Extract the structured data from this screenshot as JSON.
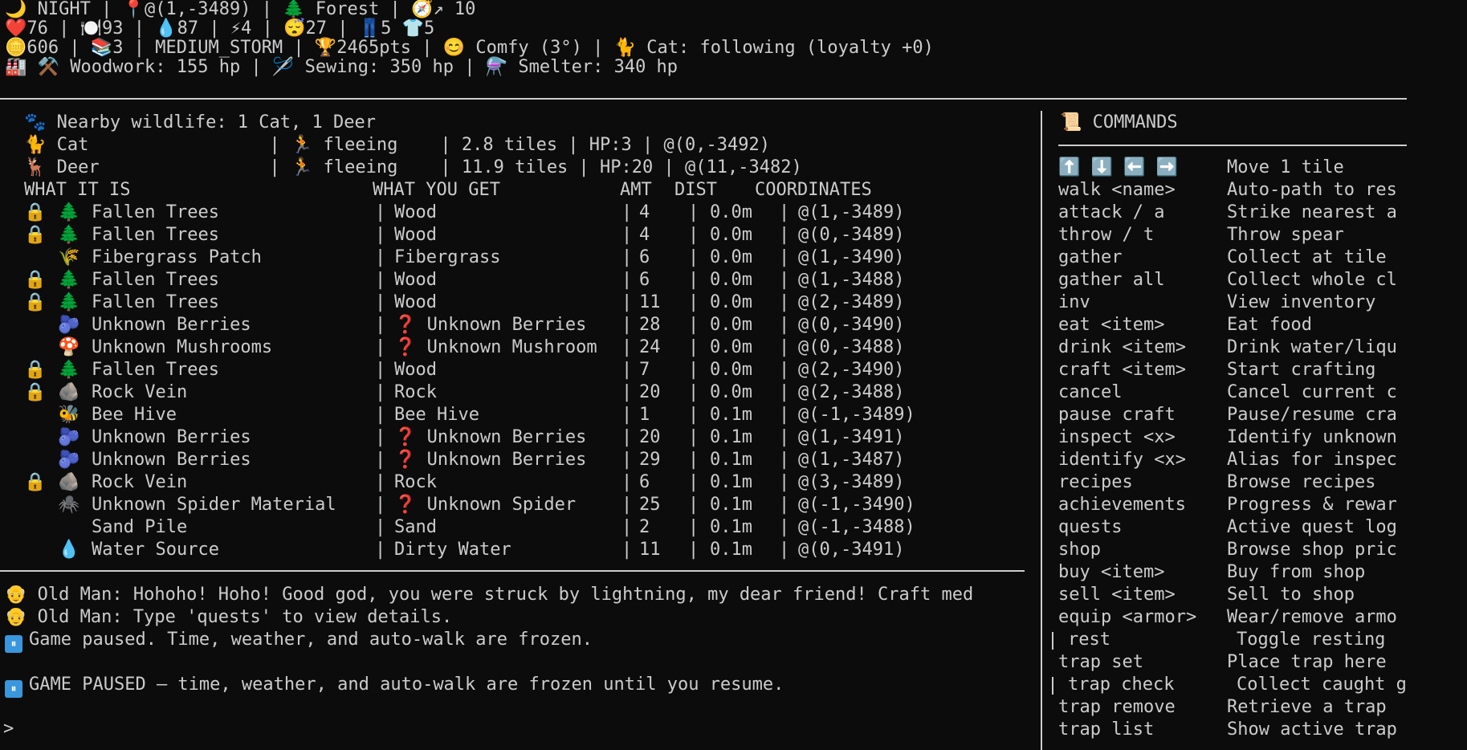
{
  "status": {
    "line1": "🌙 NIGHT | 📍@(1,-3489) | 🌲 Forest | 🧭↗ 10",
    "line2": "❤️76 | 🍽️93 | 💧87 | ⚡4 | 😴27 | 👖5 👕5",
    "line3": "🪙606 | 📚3 | MEDIUM_STORM | 🏆2465pts | 😊 Comfy (3°) | 🐈 Cat: following (loyalty +0)",
    "line4": "🏭 ⚒️ Woodwork: 155 hp | 🪡 Sewing: 350 hp | ⚗️ Smelter: 340 hp"
  },
  "wildlife": {
    "summary": "🐾 Nearby wildlife: 1 Cat, 1 Deer",
    "animals": [
      "🐈 Cat                 | 🏃 fleeing    | 2.8 tiles | HP:3 | @(0,-3492)",
      "🦌 Deer                | 🏃 fleeing    | 11.9 tiles | HP:20 | @(11,-3482)"
    ]
  },
  "table": {
    "headers": {
      "what": "WHAT IT IS",
      "get": "WHAT YOU GET",
      "amt": "AMT",
      "dist": "DIST",
      "coords": "COORDINATES"
    },
    "rows": [
      {
        "lock": "🔒",
        "icon": "🌲",
        "name": "Fallen Trees",
        "get": "Wood",
        "amt": "4",
        "dist": "0.0m",
        "coords": "@(1,-3489)"
      },
      {
        "lock": "🔒",
        "icon": "🌲",
        "name": "Fallen Trees",
        "get": "Wood",
        "amt": "4",
        "dist": "0.0m",
        "coords": "@(0,-3489)"
      },
      {
        "lock": "",
        "icon": "🌾",
        "name": "Fibergrass Patch",
        "get": "Fibergrass",
        "amt": "6",
        "dist": "0.0m",
        "coords": "@(1,-3490)"
      },
      {
        "lock": "🔒",
        "icon": "🌲",
        "name": "Fallen Trees",
        "get": "Wood",
        "amt": "6",
        "dist": "0.0m",
        "coords": "@(1,-3488)"
      },
      {
        "lock": "🔒",
        "icon": "🌲",
        "name": "Fallen Trees",
        "get": "Wood",
        "amt": "11",
        "dist": "0.0m",
        "coords": "@(2,-3489)"
      },
      {
        "lock": "",
        "icon": "🫐",
        "name": "Unknown Berries",
        "get": "❓ Unknown Berries",
        "amt": "28",
        "dist": "0.0m",
        "coords": "@(0,-3490)"
      },
      {
        "lock": "",
        "icon": "🍄",
        "name": "Unknown Mushrooms",
        "get": "❓ Unknown Mushroom",
        "amt": "24",
        "dist": "0.0m",
        "coords": "@(0,-3488)"
      },
      {
        "lock": "🔒",
        "icon": "🌲",
        "name": "Fallen Trees",
        "get": "Wood",
        "amt": "7",
        "dist": "0.0m",
        "coords": "@(2,-3490)"
      },
      {
        "lock": "🔒",
        "icon": "🪨",
        "name": "Rock Vein",
        "get": "Rock",
        "amt": "20",
        "dist": "0.0m",
        "coords": "@(2,-3488)"
      },
      {
        "lock": "",
        "icon": "🐝",
        "name": "Bee Hive",
        "get": "Bee Hive",
        "amt": "1",
        "dist": "0.1m",
        "coords": "@(-1,-3489)"
      },
      {
        "lock": "",
        "icon": "🫐",
        "name": "Unknown Berries",
        "get": "❓ Unknown Berries",
        "amt": "20",
        "dist": "0.1m",
        "coords": "@(1,-3491)"
      },
      {
        "lock": "",
        "icon": "🫐",
        "name": "Unknown Berries",
        "get": "❓ Unknown Berries",
        "amt": "29",
        "dist": "0.1m",
        "coords": "@(1,-3487)"
      },
      {
        "lock": "🔒",
        "icon": "🪨",
        "name": "Rock Vein",
        "get": "Rock",
        "amt": "6",
        "dist": "0.1m",
        "coords": "@(3,-3489)"
      },
      {
        "lock": "",
        "icon": "🕷️",
        "name": "Unknown Spider Material",
        "get": "❓ Unknown Spider",
        "amt": "25",
        "dist": "0.1m",
        "coords": "@(-1,-3490)"
      },
      {
        "lock": "",
        "icon": "",
        "name": "Sand Pile",
        "get": "Sand",
        "amt": "2",
        "dist": "0.1m",
        "coords": "@(-1,-3488)"
      },
      {
        "lock": "",
        "icon": "💧",
        "name": "Water Source",
        "get": "Dirty Water",
        "amt": "11",
        "dist": "0.1m",
        "coords": "@(0,-3491)"
      }
    ]
  },
  "messages": {
    "m1": "👴 Old Man: Hohoho! Hoho! Good god, you were struck by lightning, my dear friend! Craft med",
    "m2": "👴 Old Man: Type 'quests' to view details.",
    "m3": "Game paused. Time, weather, and auto-walk are frozen.",
    "m4": "GAME PAUSED — time, weather, and auto-walk are frozen until you resume.",
    "pause_icon": "⏸"
  },
  "prompt": ">",
  "commands": {
    "title": "📜 COMMANDS",
    "items": [
      {
        "cmd": "⬆️ ⬇️ ⬅️ ➡️",
        "desc": "Move 1 tile"
      },
      {
        "cmd": "walk <name>",
        "desc": "Auto-path to res"
      },
      {
        "cmd": "attack / a",
        "desc": "Strike nearest a"
      },
      {
        "cmd": "throw / t",
        "desc": "Throw spear"
      },
      {
        "cmd": "gather",
        "desc": "Collect at tile"
      },
      {
        "cmd": "gather all",
        "desc": "Collect whole cl"
      },
      {
        "cmd": "inv",
        "desc": "View inventory"
      },
      {
        "cmd": "eat <item>",
        "desc": "Eat food"
      },
      {
        "cmd": "drink <item>",
        "desc": "Drink water/liqu"
      },
      {
        "cmd": "craft <item>",
        "desc": "Start crafting"
      },
      {
        "cmd": "cancel",
        "desc": "Cancel current c"
      },
      {
        "cmd": "pause craft",
        "desc": "Pause/resume cra"
      },
      {
        "cmd": "inspect <x>",
        "desc": "Identify unknown"
      },
      {
        "cmd": "identify <x>",
        "desc": "Alias for inspec"
      },
      {
        "cmd": "recipes",
        "desc": "Browse recipes"
      },
      {
        "cmd": "achievements",
        "desc": "Progress & rewar"
      },
      {
        "cmd": "quests",
        "desc": "Active quest log"
      },
      {
        "cmd": "shop",
        "desc": "Browse shop pric"
      },
      {
        "cmd": "buy <item>",
        "desc": "Buy from shop"
      },
      {
        "cmd": "sell <item>",
        "desc": "Sell to shop"
      },
      {
        "cmd": "equip <armor>",
        "desc": "Wear/remove armo"
      },
      {
        "cmd": "rest",
        "desc": "Toggle resting"
      },
      {
        "cmd": "trap set",
        "desc": "Place trap here"
      },
      {
        "cmd": "trap check",
        "desc": "Collect caught g"
      },
      {
        "cmd": "trap remove",
        "desc": "Retrieve a trap"
      },
      {
        "cmd": "trap list",
        "desc": "Show active trap"
      }
    ]
  },
  "colors": {
    "background": "#0c0c0c",
    "text": "#cccccc",
    "pause_badge": "#3a96dd"
  }
}
